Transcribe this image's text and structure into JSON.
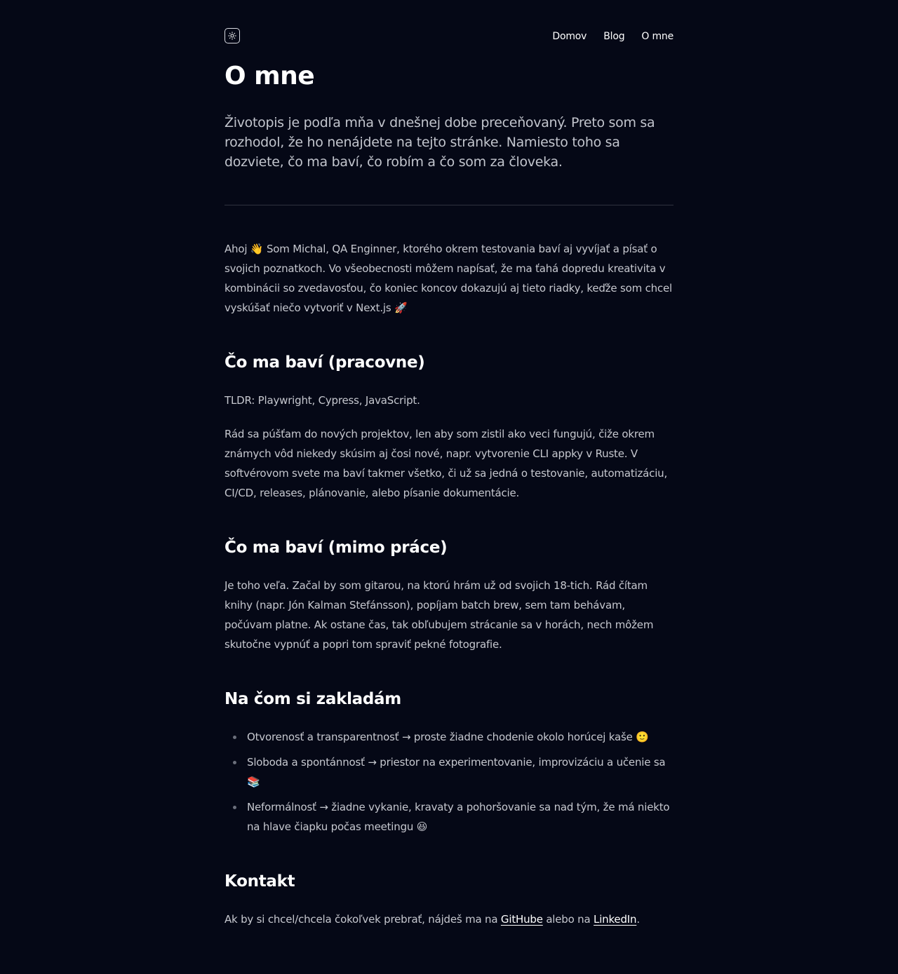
{
  "nav": {
    "items": [
      "Domov",
      "Blog",
      "O mne"
    ]
  },
  "page": {
    "title": "O mne",
    "lead": "Životopis je podľa mňa v dnešnej dobe preceňovaný. Preto som sa rozhodol, že ho nenájdete na tejto stránke. Namiesto toho sa dozviete, čo ma baví, čo robím a čo som za človeka."
  },
  "intro": {
    "before_wave": "Ahoj",
    "wave_emoji": "👋",
    "text": "Som Michal, QA Enginner, ktorého okrem testovania baví aj vyvíjať a písať o svojich poznatkoch. Vo všeobecnosti môžem napísať, že ma ťahá dopredu kreativita v kombinácii so zvedavosťou, čo koniec koncov dokazujú aj tieto riadky, keďže som chcel vyskúšať niečo vytvoriť v Next.js",
    "rocket_emoji": "🚀"
  },
  "work": {
    "heading": "Čo ma baví (pracovne)",
    "tldr": "TLDR: Playwright, Cypress, JavaScript.",
    "text": "Rád sa púšťam do nových projektov, len aby som zistil ako veci fungujú, čiže okrem známych vôd niekedy skúsim aj čosi nové, napr. vytvorenie CLI appky v Ruste. V softvérovom svete ma baví takmer všetko, či už sa jedná o testovanie, automatizáciu, CI/CD, releases, plánovanie, alebo písanie dokumentácie."
  },
  "hobbies": {
    "heading": "Čo ma baví (mimo práce)",
    "text": "Je toho veľa. Začal by som gitarou, na ktorú hrám už od svojich 18-tich. Rád čítam knihy (napr. Jón Kalman Stefánsson), popíjam batch brew, sem tam behávam, počúvam platne. Ak ostane čas, tak obľubujem strácanie sa v horách, nech môžem skutočne vypnúť a popri tom spraviť pekné fotografie."
  },
  "values": {
    "heading": "Na čom si zakladám",
    "items": [
      {
        "text": "Otvorenosť a transparentnosť → proste žiadne chodenie okolo horúcej kaše",
        "emoji": "🙂"
      },
      {
        "text": "Sloboda a spontánnosť → priestor na experimentovanie, improvizáciu a učenie sa",
        "emoji": "📚"
      },
      {
        "text": "Neformálnosť → žiadne vykanie, kravaty a pohoršovanie sa nad tým, že má niekto na hlave čiapku počas meetingu",
        "emoji": "😆"
      }
    ]
  },
  "contact": {
    "heading": "Kontakt",
    "text_before": "Ak by si chcel/chcela čokoľvek prebrať, nájdeš ma na",
    "github_label": "GitHube",
    "text_middle": "alebo na",
    "linkedin_label": "LinkedIn",
    "text_after": "."
  }
}
